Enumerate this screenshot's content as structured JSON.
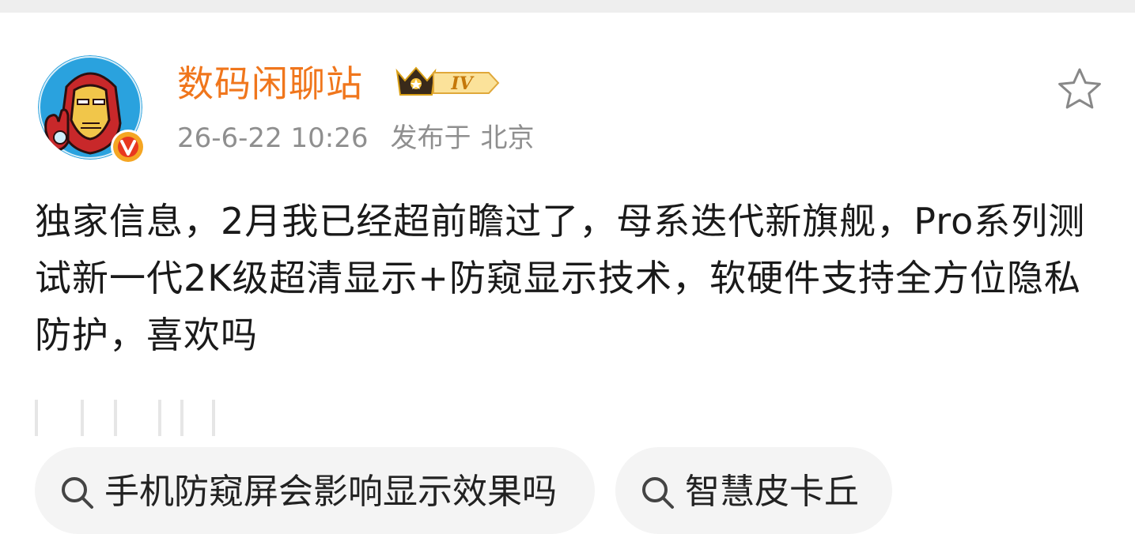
{
  "post": {
    "author": {
      "name": "数码闲聊站",
      "level": "IV",
      "verified_icon": "verified-v-badge",
      "avatar_icon": "iron-man-avatar"
    },
    "timestamp": "26-6-22 10:26",
    "location_prefix": "发布于",
    "location": "北京",
    "content": "独家信息，2月我已经超前瞻过了，母系迭代新旗舰，Pro系列测试新一代2K级超清显示+防窥显示技术，软硬件支持全方位隐私防护，喜欢吗",
    "favorite_icon": "star-outline-icon"
  },
  "topics": [
    {
      "label": "手机防窥屏会影响显示效果吗",
      "icon": "search-icon"
    },
    {
      "label": "智慧皮卡丘",
      "icon": "search-icon"
    }
  ],
  "colors": {
    "username": "#f0761c",
    "meta_text": "#8f8f8f",
    "body_text": "#1a1a1a",
    "chip_background": "#f4f4f4",
    "top_strip": "#eeeeee",
    "verified_badge": "#f5a623"
  }
}
